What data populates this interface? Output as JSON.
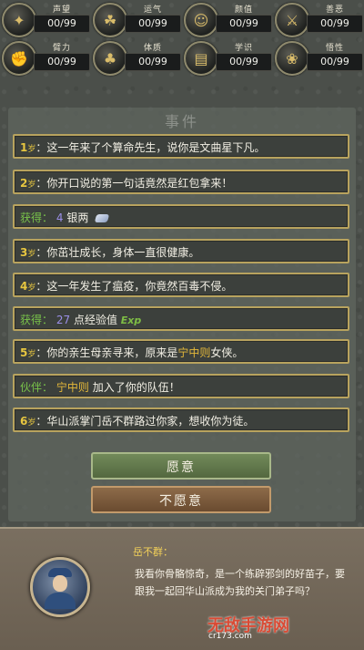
{
  "stats": [
    {
      "label": "声望",
      "value": "00/99",
      "icon": "scroll-icon"
    },
    {
      "label": "运气",
      "value": "00/99",
      "icon": "clover-icon"
    },
    {
      "label": "颜值",
      "value": "00/99",
      "icon": "face-icon"
    },
    {
      "label": "善恶",
      "value": "00/99",
      "icon": "crossed-swords-icon"
    },
    {
      "label": "臂力",
      "value": "00/99",
      "icon": "fist-icon"
    },
    {
      "label": "体质",
      "value": "00/99",
      "icon": "body-icon"
    },
    {
      "label": "学识",
      "value": "00/99",
      "icon": "book-icon"
    },
    {
      "label": "悟性",
      "value": "00/99",
      "icon": "lotus-icon"
    }
  ],
  "panel": {
    "title": "事件"
  },
  "events": [
    {
      "age": "1",
      "unit": "岁",
      "sep": "：",
      "text": "这一年来了个算命先生，说你是文曲星下凡。"
    },
    {
      "age": "2",
      "unit": "岁",
      "sep": "：",
      "text": "你开口说的第一句话竟然是红包拿来！"
    },
    {
      "gain_label": "获得：",
      "num": "4",
      "text": "银两"
    },
    {
      "age": "3",
      "unit": "岁",
      "sep": "：",
      "text": "你茁壮成长，身体一直很健康。"
    },
    {
      "age": "4",
      "unit": "岁",
      "sep": "：",
      "text": "这一年发生了瘟疫，你竟然百毒不侵。"
    },
    {
      "gain_label": "获得：",
      "num": "27",
      "text": "点经验值",
      "exp": "Exp"
    },
    {
      "age": "5",
      "unit": "岁",
      "sep": "：",
      "text1": "你的亲生母亲寻来，原来是",
      "name": "宁中则",
      "text2": "女侠。"
    },
    {
      "gain_label": "伙伴：",
      "name": "宁中则",
      "text": "加入了你的队伍！"
    },
    {
      "age": "6",
      "unit": "岁",
      "sep": "：",
      "text": "华山派掌门岳不群路过你家，想收你为徒。"
    }
  ],
  "buttons": {
    "yes": "愿意",
    "no": "不愿意"
  },
  "dialog": {
    "speaker": "岳不群：",
    "text": "我看你骨骼惊奇，是一个练辟邪剑的好苗子，要跟我一起回华山派成为我的关门弟子吗？"
  },
  "watermark": {
    "main": "无敌手游网",
    "sub": "cr173.com"
  }
}
